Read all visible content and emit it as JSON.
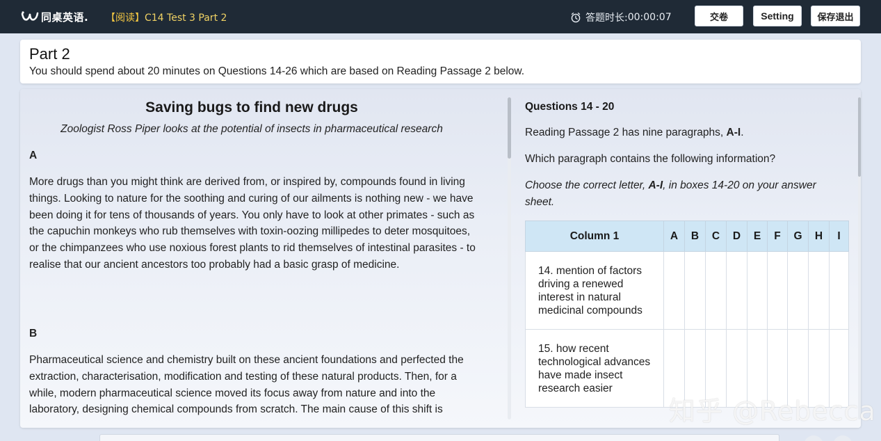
{
  "topbar": {
    "logo_text": "同桌英语.",
    "doc_title_bracket": "【阅读】",
    "doc_title_rest": "C14 Test 3 Part 2",
    "timer_label": "答题时长:",
    "timer_value": "00:00:07",
    "submit_label": "交卷",
    "setting_label": "Setting",
    "save_exit_label": "保存退出",
    "colors": {
      "bar": "#1f2a36",
      "title": "#f5c842"
    }
  },
  "part": {
    "title": "Part 2",
    "description": "You should spend about 20 minutes on Questions 14-26 which are based on Reading Passage 2 below."
  },
  "passage": {
    "title": "Saving bugs to find new drugs",
    "subtitle": "Zoologist Ross Piper looks at the potential of insects in pharmaceutical research",
    "paragraphs": [
      {
        "letter": "A",
        "text": " More drugs than you might think are derived from, or inspired by, compounds found in living things. Looking to nature for the soothing and curing of our ailments is nothing new - we have been doing it for tens of thousands of years. You only have to look at other primates - such as the capuchin monkeys who rub themselves with toxin-oozing millipedes to deter mosquitoes, or the chimpanzees who use noxious forest plants to rid themselves of intestinal parasites - to realise that our ancient ancestors too probably had a basic grasp of medicine."
      },
      {
        "letter": "B",
        "text": " Pharmaceutical science and chemistry built on these ancient foundations and perfected the extraction, characterisation, modification and testing of these natural products. Then, for a while, modern pharmaceutical science moved its focus away from nature and into the laboratory, designing chemical compounds from scratch. The main cause of this shift is"
      }
    ]
  },
  "questions": {
    "heading": "Questions 14 - 20",
    "line1_pre": "Reading Passage 2 has nine paragraphs, ",
    "line1_bold": "A-I",
    "line1_post": ".",
    "line2": "Which paragraph contains the following information?",
    "instr_pre": "Choose the correct letter, ",
    "instr_bold": "A-I",
    "instr_post": ", in boxes 14-20 on your answer sheet.",
    "table": {
      "column1": "Column 1",
      "letters": [
        "A",
        "B",
        "C",
        "D",
        "E",
        "F",
        "G",
        "H",
        "I"
      ],
      "rows": [
        "14. mention of factors driving a renewed interest in natural medicinal compounds",
        "15. how recent technological advances have made insect research easier"
      ]
    }
  },
  "watermark": "知乎 @Rebecca"
}
